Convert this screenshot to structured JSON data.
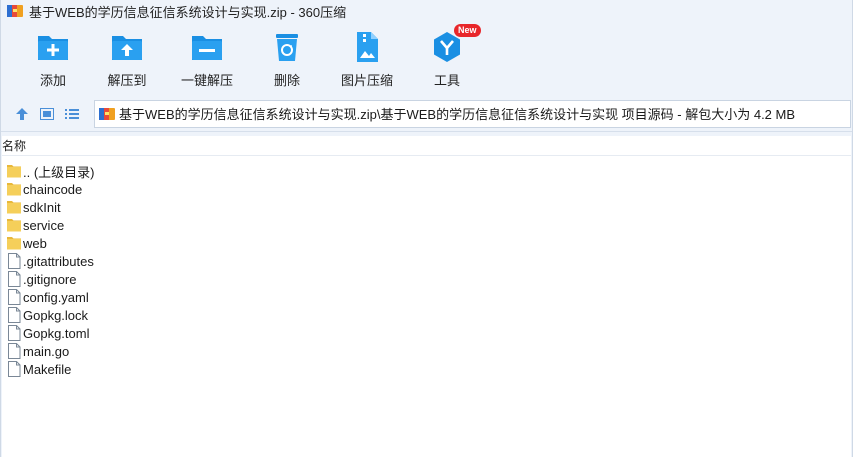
{
  "window": {
    "title": "基于WEB的学历信息征信系统设计与实现.zip - 360压缩"
  },
  "toolbar": {
    "items": [
      {
        "label": "添加",
        "icon": "add-icon"
      },
      {
        "label": "解压到",
        "icon": "extract-to-icon"
      },
      {
        "label": "一键解压",
        "icon": "one-click-extract-icon"
      },
      {
        "label": "删除",
        "icon": "delete-icon"
      },
      {
        "label": "图片压缩",
        "icon": "image-compress-icon"
      },
      {
        "label": "工具",
        "icon": "tools-icon",
        "badge": "New"
      }
    ]
  },
  "address": {
    "path": "基于WEB的学历信息征信系统设计与实现.zip\\基于WEB的学历信息征信系统设计与实现 项目源码 - 解包大小为 4.2 MB"
  },
  "list": {
    "column_name": "名称",
    "rows": [
      {
        "name": ".. (上级目录)",
        "type": "folder"
      },
      {
        "name": "chaincode",
        "type": "folder"
      },
      {
        "name": "sdkInit",
        "type": "folder"
      },
      {
        "name": "service",
        "type": "folder"
      },
      {
        "name": "web",
        "type": "folder"
      },
      {
        "name": ".gitattributes",
        "type": "file"
      },
      {
        "name": ".gitignore",
        "type": "file"
      },
      {
        "name": "config.yaml",
        "type": "file"
      },
      {
        "name": "Gopkg.lock",
        "type": "file"
      },
      {
        "name": "Gopkg.toml",
        "type": "file"
      },
      {
        "name": "main.go",
        "type": "file"
      },
      {
        "name": "Makefile",
        "type": "file"
      }
    ]
  },
  "colors": {
    "accent": "#1a8fe3",
    "folder": "#f5cf5a",
    "badge": "#e8262a",
    "chrome": "#eef3fa"
  }
}
